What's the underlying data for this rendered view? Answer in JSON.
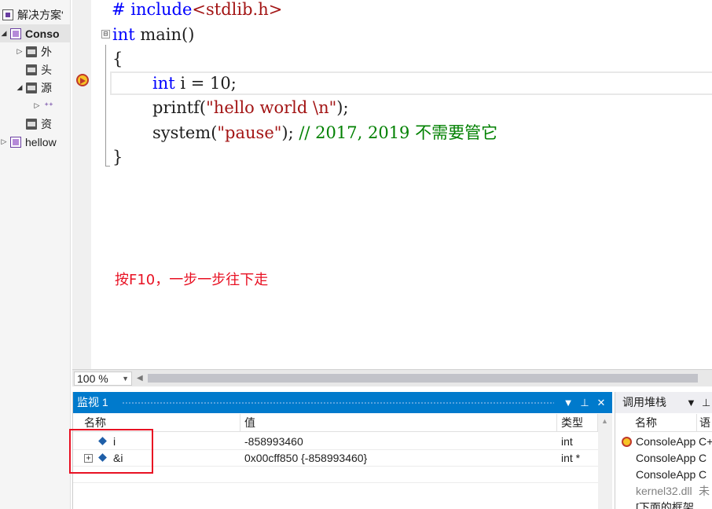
{
  "solution_explorer": {
    "items": [
      {
        "label": "解决方案'",
        "expander": ""
      },
      {
        "label": "Conso",
        "expander": "◢"
      },
      {
        "label": "外",
        "expander": "▷"
      },
      {
        "label": "头",
        "expander": ""
      },
      {
        "label": "源",
        "expander": "◢"
      },
      {
        "label": "⁺⁺",
        "expander": "▷"
      },
      {
        "label": "资",
        "expander": ""
      },
      {
        "label": "hellow",
        "expander": "▷"
      }
    ]
  },
  "editor": {
    "fold_open": "⊟",
    "lines": [
      {
        "kw": "# include",
        "str": "<stdlib.h>"
      },
      {
        "kw": "int",
        "text": " main()"
      },
      {
        "text": "{"
      },
      {
        "kw": "int",
        "text": " i = 10;"
      },
      {
        "text": "printf(",
        "str": "\"hello world \\n\"",
        "tail": ");"
      },
      {
        "text": "system(",
        "str": "\"pause\"",
        "tail": "); ",
        "cmt": "// 2017, 2019 不需要管它"
      },
      {
        "text": "}"
      }
    ],
    "annotation": "按F10，一步一步往下走"
  },
  "zoom": {
    "value": "100 %",
    "arrow": "▼",
    "scroll_left": "◀"
  },
  "watch": {
    "title": "监视 1",
    "buttons": {
      "dropdown": "▼",
      "pin": "⊥",
      "close": "✕"
    },
    "columns": {
      "name": "名称",
      "value": "值",
      "type": "类型"
    },
    "rows": [
      {
        "name": "i",
        "value": "-858993460",
        "type": "int",
        "expandable": false
      },
      {
        "name": "&i",
        "value": "0x00cff850 {-858993460}",
        "type": "int *",
        "expandable": true
      }
    ],
    "expand_glyph": "+",
    "scroll_up": "▲"
  },
  "callstack": {
    "title": "调用堆栈",
    "buttons": {
      "dropdown": "▼",
      "pin": "⊥"
    },
    "columns": {
      "name": "名称",
      "lang": "语"
    },
    "rows": [
      {
        "name": "ConsoleApp",
        "lang": "C+"
      },
      {
        "name": "ConsoleApp",
        "lang": "C"
      },
      {
        "name": "ConsoleApp",
        "lang": "C"
      },
      {
        "name": "kernel32.dll",
        "lang": "未"
      },
      {
        "name": "[下面的框架",
        "lang": ""
      }
    ]
  },
  "colors": {
    "accent": "#007acc",
    "keyword": "#0000ff",
    "string": "#a31515",
    "comment": "#008000",
    "annotation": "#e81123"
  }
}
